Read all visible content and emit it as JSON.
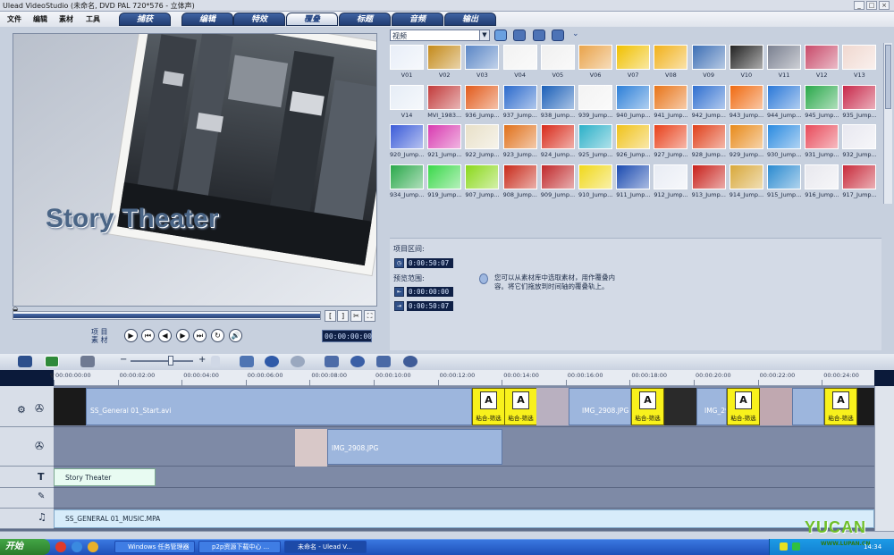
{
  "window": {
    "title": "Ulead VideoStudio (未命名, DVD PAL 720*576 - 立体声)"
  },
  "menu": [
    "文件",
    "编辑",
    "素材",
    "工具"
  ],
  "tabs": [
    {
      "label": "捕获",
      "active": false
    },
    {
      "label": "编辑",
      "active": false
    },
    {
      "label": "特效",
      "active": false
    },
    {
      "label": "覆叠",
      "active": true
    },
    {
      "label": "标题",
      "active": false
    },
    {
      "label": "音频",
      "active": false
    },
    {
      "label": "输出",
      "active": false
    }
  ],
  "preview": {
    "overlay_title": "Story Theater",
    "mode_label": "项 目\n素 材",
    "timecode": "00:00:00:00",
    "mark_in": "[",
    "mark_out": "]"
  },
  "library": {
    "category": "视频",
    "items": [
      {
        "label": "V01",
        "color": "#e8eef8"
      },
      {
        "label": "V02",
        "color": "#c48a1a"
      },
      {
        "label": "V03",
        "color": "#5a86c6"
      },
      {
        "label": "V04",
        "color": "#f2f2f2"
      },
      {
        "label": "V05",
        "color": "#f0f0f0"
      },
      {
        "label": "V06",
        "color": "#e9a34a"
      },
      {
        "label": "V07",
        "color": "#f0c000"
      },
      {
        "label": "V08",
        "color": "#f1b11a"
      },
      {
        "label": "V09",
        "color": "#3d6fb5"
      },
      {
        "label": "V10",
        "color": "#222222"
      },
      {
        "label": "V11",
        "color": "#7a8090"
      },
      {
        "label": "V12",
        "color": "#c84a6a"
      },
      {
        "label": "V13",
        "color": "#f0d8d0"
      },
      {
        "label": "V14",
        "color": "#e6edf6"
      },
      {
        "label": "MVI_1983...",
        "color": "#c23a3a"
      },
      {
        "label": "936_Jump...",
        "color": "#e25a1a"
      },
      {
        "label": "937_Jump...",
        "color": "#2b6acc"
      },
      {
        "label": "938_Jump...",
        "color": "#1a5fb8"
      },
      {
        "label": "939_Jump...",
        "color": "#f3f3f3"
      },
      {
        "label": "940_Jump...",
        "color": "#2c7fd8"
      },
      {
        "label": "941_Jump...",
        "color": "#e87418"
      },
      {
        "label": "942_Jump...",
        "color": "#2f6fd0"
      },
      {
        "label": "943_Jump...",
        "color": "#f06a10"
      },
      {
        "label": "944_Jump...",
        "color": "#2a78d8"
      },
      {
        "label": "945_Jump...",
        "color": "#29a84a"
      },
      {
        "label": "935_Jump...",
        "color": "#c8284a"
      },
      {
        "label": "920_Jump...",
        "color": "#3b5bd8"
      },
      {
        "label": "921_Jump...",
        "color": "#d83ab0"
      },
      {
        "label": "922_Jump...",
        "color": "#e8e0c8"
      },
      {
        "label": "923_Jump...",
        "color": "#e0701a"
      },
      {
        "label": "924_Jump...",
        "color": "#d82a1a"
      },
      {
        "label": "925_Jump...",
        "color": "#2bb0c8"
      },
      {
        "label": "926_Jump...",
        "color": "#f0c21a"
      },
      {
        "label": "927_Jump...",
        "color": "#e8401a"
      },
      {
        "label": "928_Jump...",
        "color": "#e0401a"
      },
      {
        "label": "929_Jump...",
        "color": "#e88a1a"
      },
      {
        "label": "930_Jump...",
        "color": "#2a8ae0"
      },
      {
        "label": "931_Jump...",
        "color": "#e84a5a"
      },
      {
        "label": "932_Jump...",
        "color": "#e8e8f0"
      },
      {
        "label": "934_Jump...",
        "color": "#2aa84a"
      },
      {
        "label": "919_Jump...",
        "color": "#3ad84a"
      },
      {
        "label": "907_Jump...",
        "color": "#8ad81a"
      },
      {
        "label": "908_Jump...",
        "color": "#c82a1a"
      },
      {
        "label": "909_Jump...",
        "color": "#c0282a"
      },
      {
        "label": "910_Jump...",
        "color": "#f0d81a"
      },
      {
        "label": "911_Jump...",
        "color": "#1a4ab0"
      },
      {
        "label": "912_Jump...",
        "color": "#e8ecf4"
      },
      {
        "label": "913_Jump...",
        "color": "#c8201a"
      },
      {
        "label": "914_Jump...",
        "color": "#d8a83a"
      },
      {
        "label": "915_Jump...",
        "color": "#2a8ad0"
      },
      {
        "label": "916_Jump...",
        "color": "#e8e8ee"
      },
      {
        "label": "917_Jump...",
        "color": "#c82a3a"
      }
    ]
  },
  "options": {
    "project_duration_label": "项目区间:",
    "project_duration": "0:00:50:07",
    "preview_range_label": "预览范围:",
    "range_start": "0:00:00:00",
    "range_end": "0:00:50:07",
    "hint": "您可以从素材库中选取素材，用作覆叠内容。将它们拖放到时间轴的覆叠轨上。"
  },
  "ruler": [
    "00:00:00:00",
    "00:00:02:00",
    "00:00:04:00",
    "00:00:06:00",
    "00:00:08:00",
    "00:00:10:00",
    "00:00:12:00",
    "00:00:14:00",
    "00:00:16:00",
    "00:00:18:00",
    "00:00:20:00",
    "00:00:22:00",
    "00:00:24:00"
  ],
  "timeline": {
    "video_clip1": "SS_General 01_Start.avi",
    "video_clip2": "IMG_2908.JPG",
    "video_clip3": "IMG_2908.JPG",
    "transition_label": "粘合-筛选",
    "overlay_clip": "IMG_2908.JPG",
    "title_clip": "Story Theater",
    "music_clip": "SS_GENERAL 01_MUSIC.MPA"
  },
  "taskbar": {
    "start": "开始",
    "tasks": [
      "Windows 任务管理器",
      "p2p资源下载中心 ...",
      "未命名 - Ulead V..."
    ],
    "clock": "14:34"
  },
  "watermark": {
    "logo": "YUCAN",
    "site": "WWW.LUPAN.CN"
  }
}
